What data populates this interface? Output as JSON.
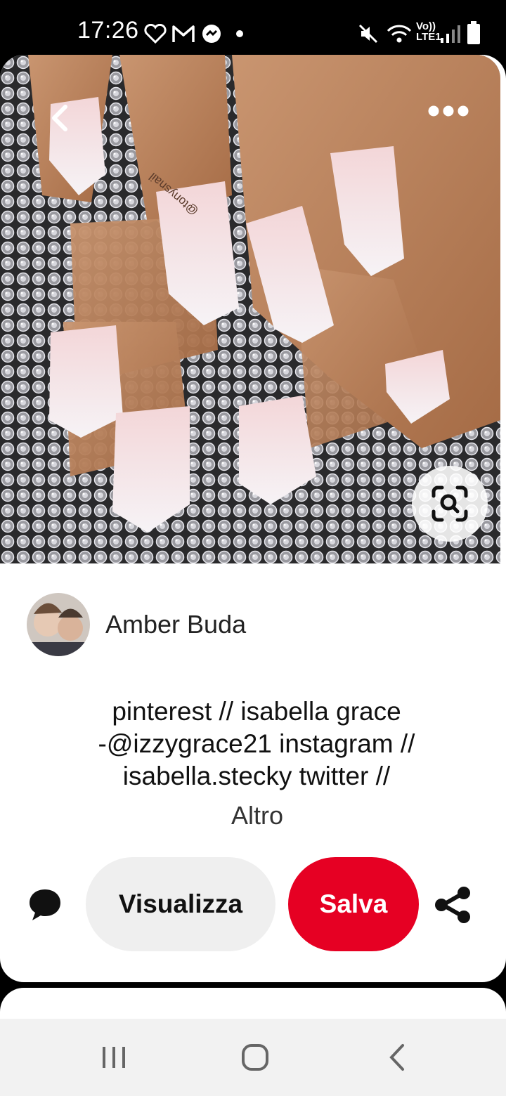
{
  "status_bar": {
    "time": "17:26",
    "network_label_top": "Vo))",
    "network_label_bottom": "LTE1",
    "icons": [
      "heart-icon",
      "gmail-icon",
      "messenger-icon",
      "dot-icon",
      "mute-icon",
      "wifi-icon",
      "signal-icon",
      "battery-icon"
    ]
  },
  "pin": {
    "image_watermark": "@tonysnail",
    "image_description": "pink ombré coffin nails on rhinestone background",
    "back_icon": "chevron-left-icon",
    "menu_icon": "more-dots-icon",
    "visual_search_icon": "visual-search-icon"
  },
  "author": {
    "name": "Amber Buda"
  },
  "description": {
    "line1": "pinterest // isabella grace",
    "line2": "-@izzygrace21 instagram //",
    "line3": "isabella.stecky twitter //",
    "more": "Altro"
  },
  "actions": {
    "comment_icon": "comment-icon",
    "visualizza_label": "Visualizza",
    "salva_label": "Salva",
    "share_icon": "share-icon"
  },
  "colors": {
    "accent_red": "#e60023",
    "button_gray": "#efefef",
    "nav_bar_bg": "#f2f2f2"
  },
  "nav_bar": {
    "icons": [
      "recent-apps-icon",
      "home-icon",
      "back-icon"
    ]
  }
}
